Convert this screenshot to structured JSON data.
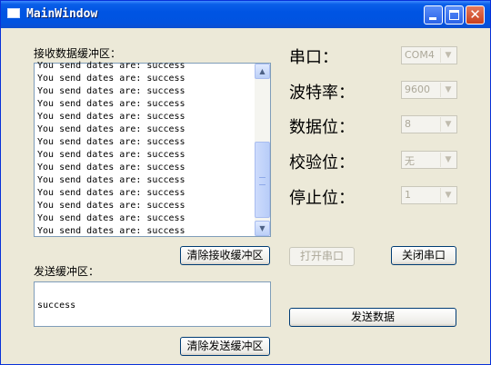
{
  "window": {
    "title": "MainWindow"
  },
  "receive": {
    "label": "接收数据缓冲区：",
    "lines": [
      "You send dates are: success",
      "You send dates are: success",
      "You send dates are: success",
      "You send dates are: success",
      "You send dates are: success",
      "You send dates are: success",
      "You send dates are: success",
      "You send dates are: success",
      "You send dates are: success",
      "You send dates are: success",
      "You send dates are: success",
      "You send dates are: success",
      "You send dates are: success",
      "You send dates are: success"
    ],
    "clear_label": "清除接收缓冲区"
  },
  "send": {
    "label": "发送缓冲区：",
    "text": "success",
    "clear_label": "清除发送缓冲区",
    "send_label": "发送数据"
  },
  "settings": {
    "port_label": "串口：",
    "port_value": "COM4",
    "baud_label": "波特率：",
    "baud_value": "9600",
    "databits_label": "数据位：",
    "databits_value": "8",
    "parity_label": "校验位：",
    "parity_value": "无",
    "stopbits_label": "停止位：",
    "stopbits_value": "1"
  },
  "actions": {
    "open_label": "打开串口",
    "close_label": "关闭串口"
  }
}
